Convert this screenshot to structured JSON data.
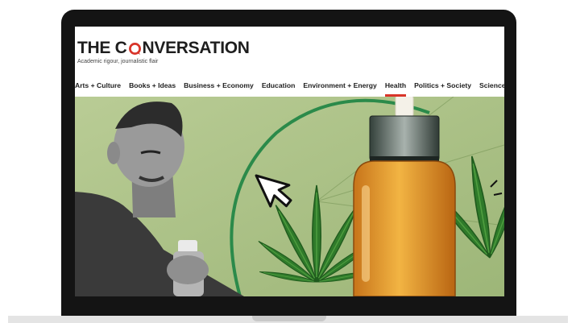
{
  "site": {
    "logo_before": "THE C",
    "logo_after": "NVERSATION",
    "tagline": "Academic rigour, journalistic flair",
    "brand_color": "#d8352a"
  },
  "nav": {
    "items": [
      {
        "label": "Arts + Culture"
      },
      {
        "label": "Books + Ideas"
      },
      {
        "label": "Business + Economy"
      },
      {
        "label": "Education"
      },
      {
        "label": "Environment + Energy"
      },
      {
        "label": "Health",
        "active": true
      },
      {
        "label": "Politics + Society"
      },
      {
        "label": "Science"
      }
    ]
  },
  "hero": {
    "icons": [
      "cursor-arrow-icon",
      "cannabis-leaf-icon",
      "oil-dropper-bottle-icon"
    ],
    "background_color": "#a9c085"
  }
}
